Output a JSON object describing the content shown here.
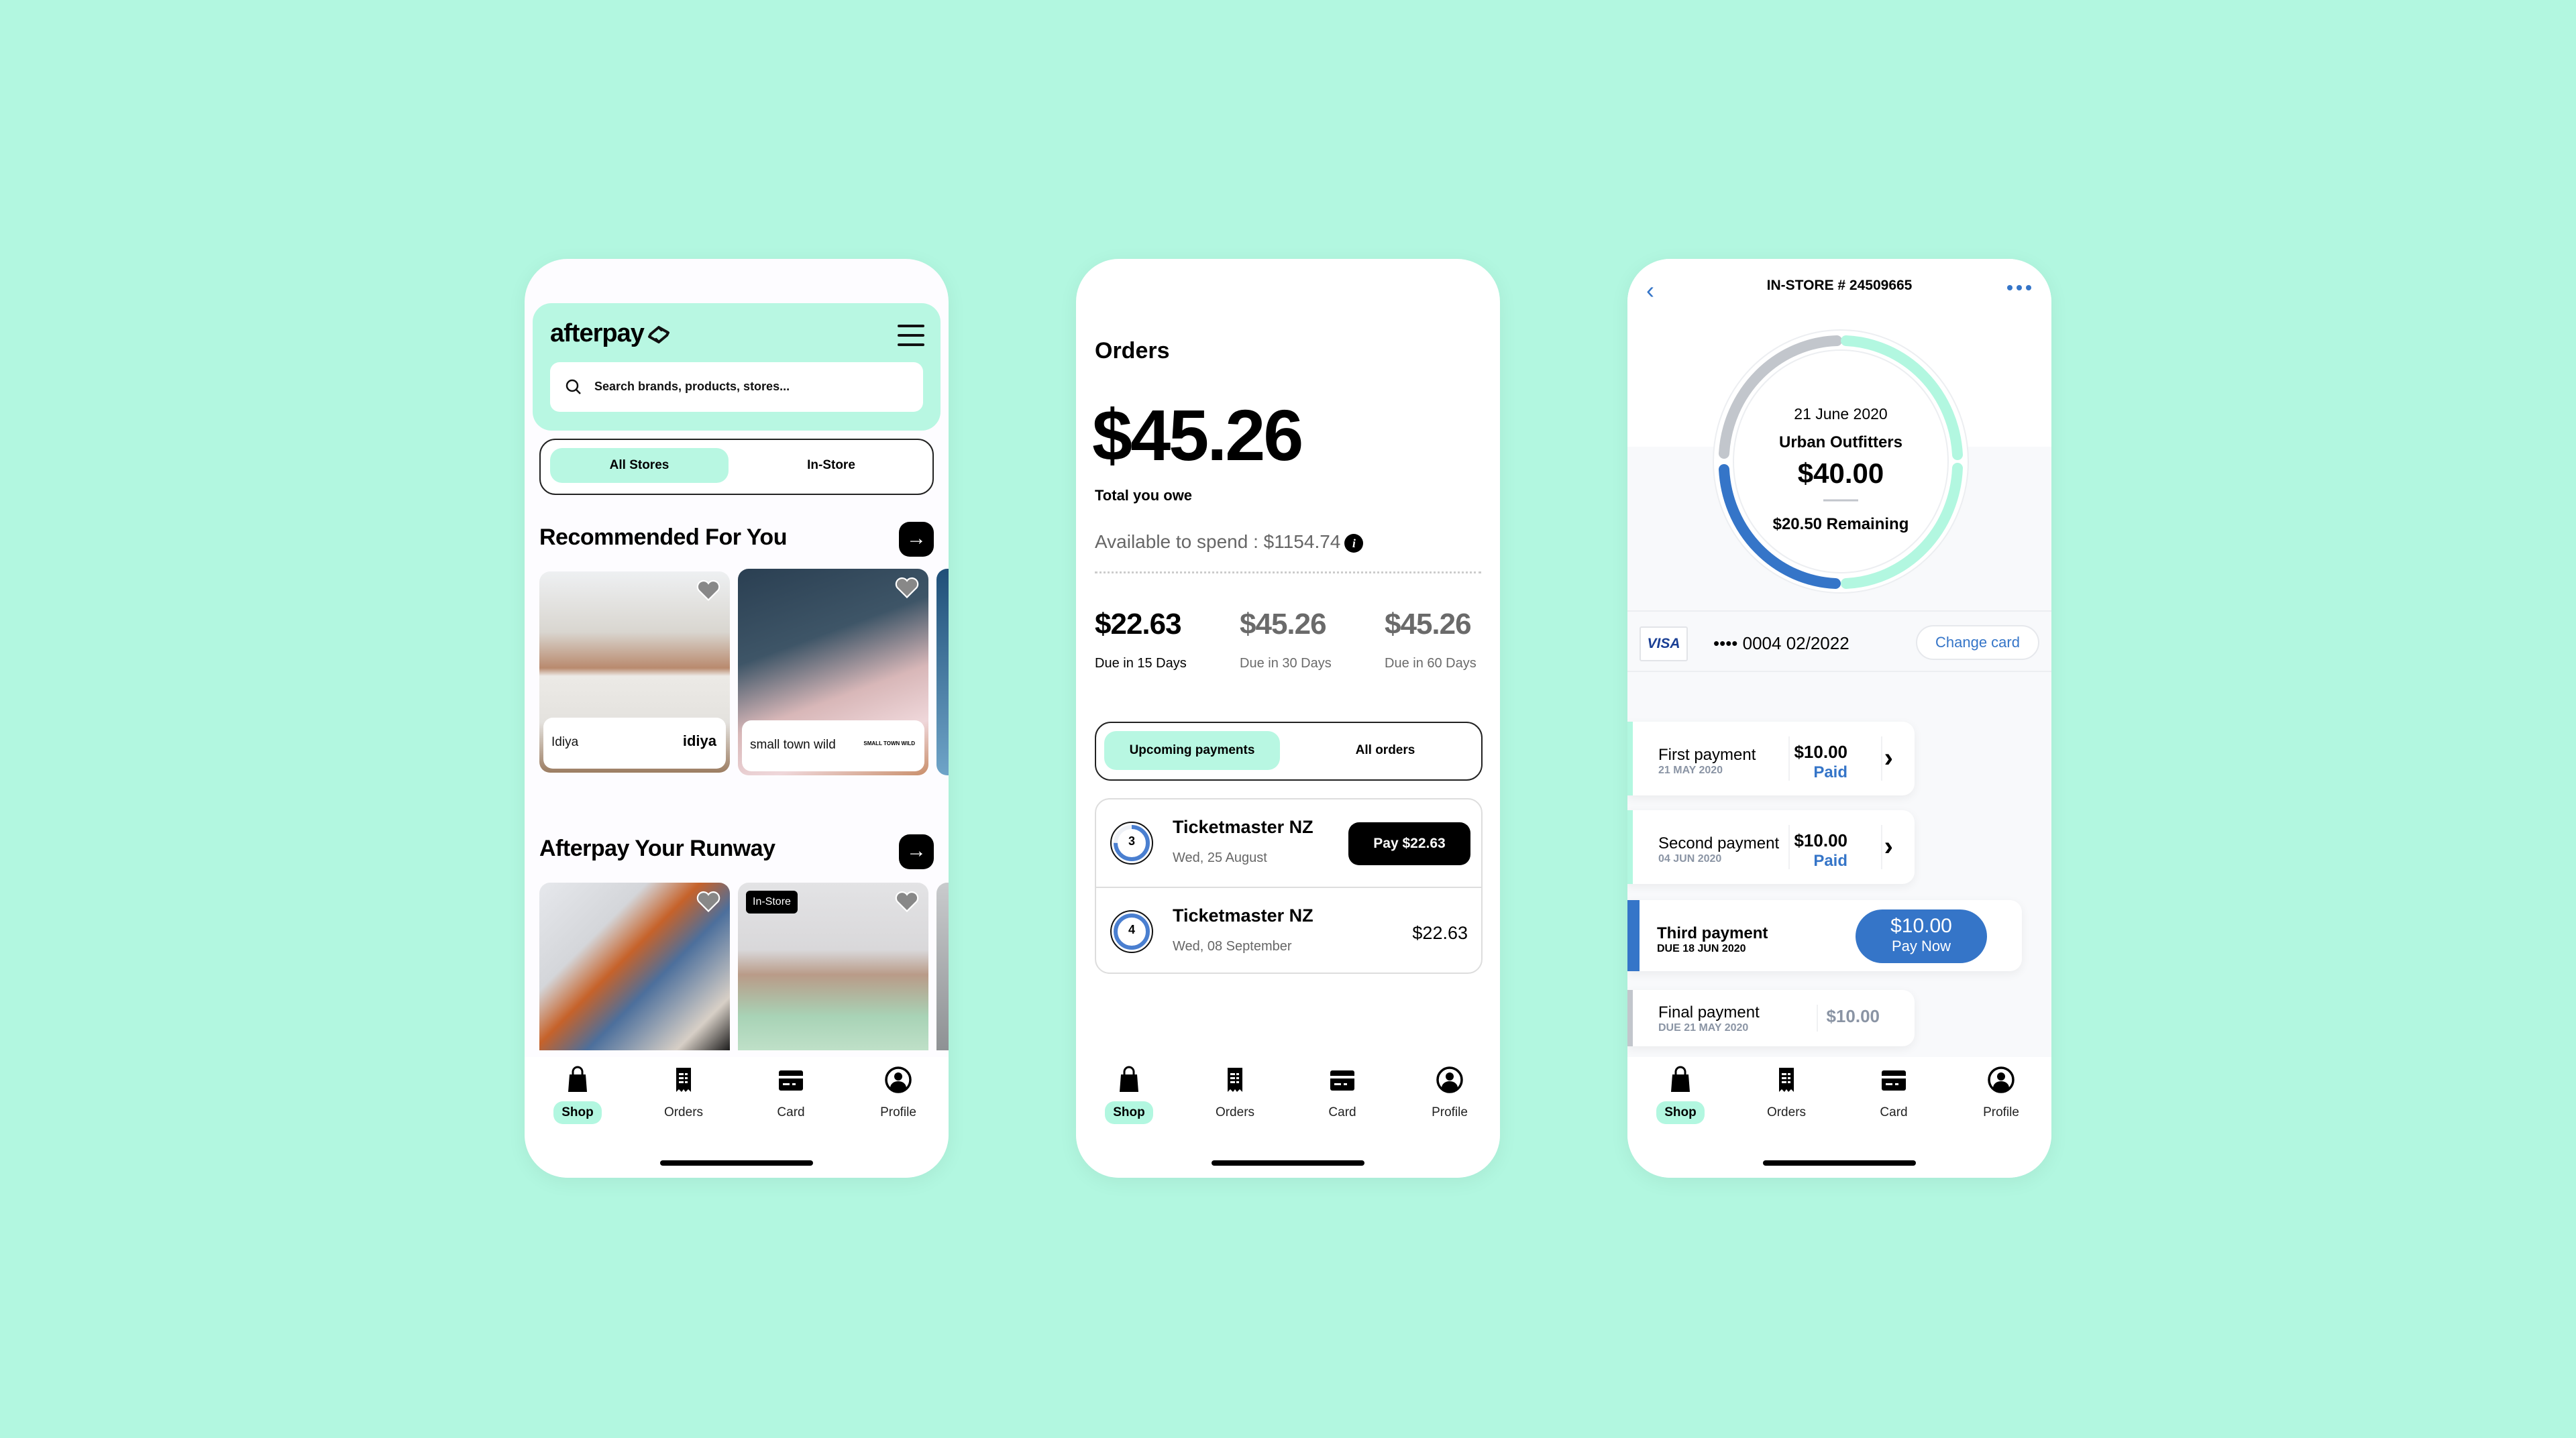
{
  "colors": {
    "background": "#b2f7e0",
    "mint": "#b8f7e2",
    "blue": "#3575c8",
    "gray": "#c0c5cc"
  },
  "tabbar": [
    {
      "label": "Shop",
      "icon": "shopping-bag-icon",
      "active": true
    },
    {
      "label": "Orders",
      "icon": "receipt-icon",
      "active": false
    },
    {
      "label": "Card",
      "icon": "credit-card-icon",
      "active": false
    },
    {
      "label": "Profile",
      "icon": "profile-icon",
      "active": false
    }
  ],
  "shop": {
    "logo": "afterpay",
    "search_placeholder": "Search brands, products, stores...",
    "segments": [
      "All Stores",
      "In-Store"
    ],
    "recommended": {
      "title": "Recommended For You",
      "cards": [
        {
          "name": "Idiya",
          "brand": "idiya"
        },
        {
          "name": "small town wild",
          "brand": "SMALL TOWN WILD"
        }
      ]
    },
    "runway": {
      "title": "Afterpay Your Runway",
      "badge": "In-Store"
    }
  },
  "orders": {
    "title": "Orders",
    "total": "$45.26",
    "total_label": "Total you owe",
    "available": "Available to spend : $1154.74",
    "due": [
      {
        "amount": "$22.63",
        "label": "Due in 15 Days"
      },
      {
        "amount": "$45.26",
        "label": "Due in 30 Days"
      },
      {
        "amount": "$45.26",
        "label": "Due in 60 Days"
      }
    ],
    "segments": [
      "Upcoming payments",
      "All orders"
    ],
    "items": [
      {
        "step": "3",
        "merchant": "Ticketmaster NZ",
        "date": "Wed, 25 August",
        "action": "Pay $22.63",
        "progress": 0.75
      },
      {
        "step": "4",
        "merchant": "Ticketmaster NZ",
        "date": "Wed, 08 September",
        "amount": "$22.63",
        "progress": 1.0
      }
    ]
  },
  "instore": {
    "title": "IN-STORE # 24509665",
    "date": "21 June 2020",
    "merchant": "Urban Outfitters",
    "amount": "$40.00",
    "remaining": "$20.50 Remaining",
    "card_brand": "VISA",
    "card_number": "•••• 0004 02/2022",
    "change_card": "Change card",
    "payments": [
      {
        "title": "First payment",
        "date": "21 MAY 2020",
        "amount": "$10.00",
        "status": "Paid"
      },
      {
        "title": "Second payment",
        "date": "04 JUN 2020",
        "amount": "$10.00",
        "status": "Paid"
      },
      {
        "title": "Third payment",
        "date": "DUE 18 JUN 2020",
        "amount": "$10.00",
        "action": "Pay Now"
      },
      {
        "title": "Final payment",
        "date": "DUE 21 MAY 2020",
        "amount": "$10.00"
      }
    ]
  }
}
